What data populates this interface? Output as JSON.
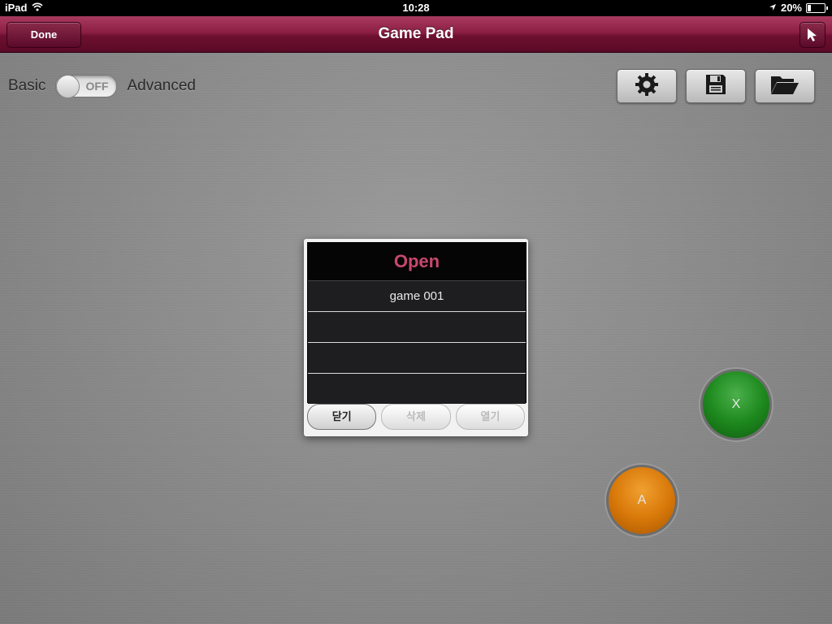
{
  "status_bar": {
    "device": "iPad",
    "time": "10:28",
    "battery": "20%",
    "battery_level": 0.2
  },
  "nav": {
    "title": "Game Pad",
    "done_label": "Done"
  },
  "mode": {
    "left_label": "Basic",
    "switch_text": "OFF",
    "right_label": "Advanced"
  },
  "toolbar": {
    "icons": [
      "gear-icon",
      "save-disk-icon",
      "folder-open-icon"
    ]
  },
  "dialog": {
    "title": "Open",
    "items": [
      "game 001",
      "",
      "",
      ""
    ],
    "buttons": [
      "닫기",
      "삭제",
      "열기"
    ]
  },
  "pad": {
    "x_label": "X",
    "a_label": "A",
    "x_color": "#1e8a1e",
    "a_color": "#d97a0a"
  },
  "colors": {
    "nav_bar": "#6e1030",
    "dialog_title": "#c8486e"
  }
}
